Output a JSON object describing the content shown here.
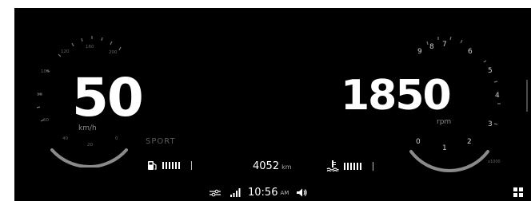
{
  "speedometer": {
    "value": "50",
    "unit": "km/h",
    "ticks": [
      "120",
      "160",
      "200",
      "100",
      "80",
      "60",
      "40",
      "20",
      "0"
    ]
  },
  "drive_mode": "SPORT",
  "tachometer": {
    "value": "1850",
    "unit": "rpm",
    "ticks": [
      "9",
      "8",
      "7",
      "6",
      "5",
      "4",
      "3",
      "0",
      "1",
      "2"
    ],
    "multiplier": "x1000"
  },
  "fuel": {
    "icon": "fuel-pump-icon",
    "bars_on": 6,
    "bars_total": 6
  },
  "odometer": {
    "value": "4052",
    "unit": "km"
  },
  "coolant": {
    "icon": "coolant-temp-icon",
    "bars_on": 6,
    "bars_total": 6
  },
  "status_bar": {
    "time": "10:56",
    "ampm": "AM",
    "icons": [
      "settings-sliders-icon",
      "signal-icon",
      "volume-icon"
    ]
  },
  "apps_icon": "apps-grid-icon"
}
